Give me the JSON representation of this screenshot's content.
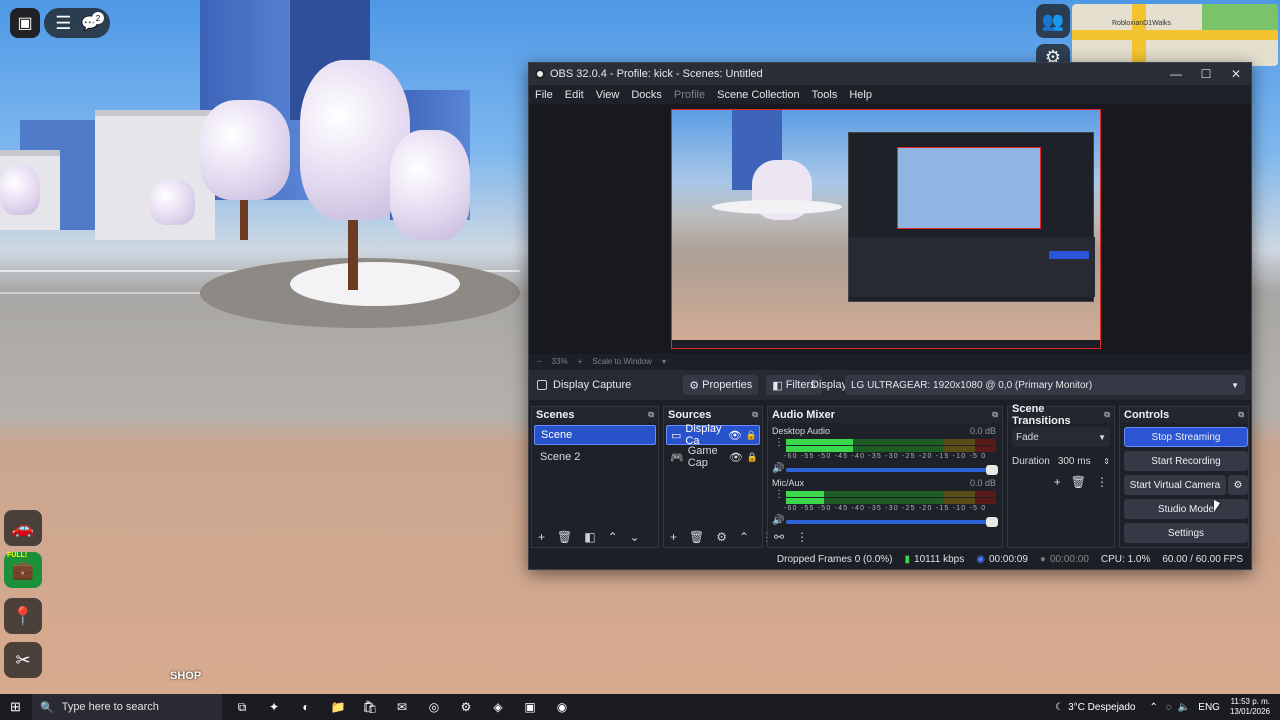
{
  "game": {
    "shop_label": "SHOP",
    "full_badge": "FULL!",
    "topbar_badge": "2",
    "map_label": "RobloxianD1Walks"
  },
  "obs": {
    "window_title": "OBS 32.0.4 - Profile: kick - Scenes: Untitled",
    "menu": [
      "File",
      "Edit",
      "View",
      "Docks",
      "Profile",
      "Scene Collection",
      "Tools",
      "Help"
    ],
    "zoom": {
      "percent": "33%",
      "scale_label": "Scale to Window"
    },
    "source_toolbar": {
      "source_name": "Display Capture",
      "properties": "Properties",
      "filters": "Filters",
      "display_label": "Display",
      "display_value": "LG ULTRAGEAR: 1920x1080 @ 0,0 (Primary Monitor)"
    },
    "scenes": {
      "title": "Scenes",
      "items": [
        "Scene",
        "Scene 2"
      ],
      "selected": 0
    },
    "sources": {
      "title": "Sources",
      "items": [
        "Display Ca",
        "Game Cap"
      ]
    },
    "audio_mixer": {
      "title": "Audio Mixer",
      "channels": [
        {
          "name": "Desktop Audio",
          "db": "0.0 dB",
          "level": 0.32,
          "volume": 1.0
        },
        {
          "name": "Mic/Aux",
          "db": "0.0 dB",
          "level": 0.18,
          "volume": 1.0
        }
      ],
      "scale": "-60 -55 -50 -45 -40 -35 -30 -25 -20 -15 -10 -5 0"
    },
    "transitions": {
      "title": "Scene Transitions",
      "type": "Fade",
      "duration_label": "Duration",
      "duration_value": "300 ms"
    },
    "controls": {
      "title": "Controls",
      "stop_streaming": "Stop Streaming",
      "start_recording": "Start Recording",
      "start_virtual_camera": "Start Virtual Camera",
      "studio_mode": "Studio Mode",
      "settings": "Settings"
    },
    "status": {
      "dropped_frames": "Dropped Frames 0 (0.0%)",
      "bitrate": "10111 kbps",
      "stream_time": "00:00:09",
      "rec_time": "00:00:00",
      "cpu": "CPU: 1.0%",
      "fps": "60.00 / 60.00 FPS"
    }
  },
  "taskbar": {
    "search_placeholder": "Type here to search",
    "weather": "3°C  Despejado",
    "language": "ENG",
    "time": "11:53 p. m.",
    "date": "13/01/2026"
  },
  "colors": {
    "accent": "#2c55d6",
    "obs_bg": "#1d1f26",
    "preview_border": "#e02a2a"
  }
}
